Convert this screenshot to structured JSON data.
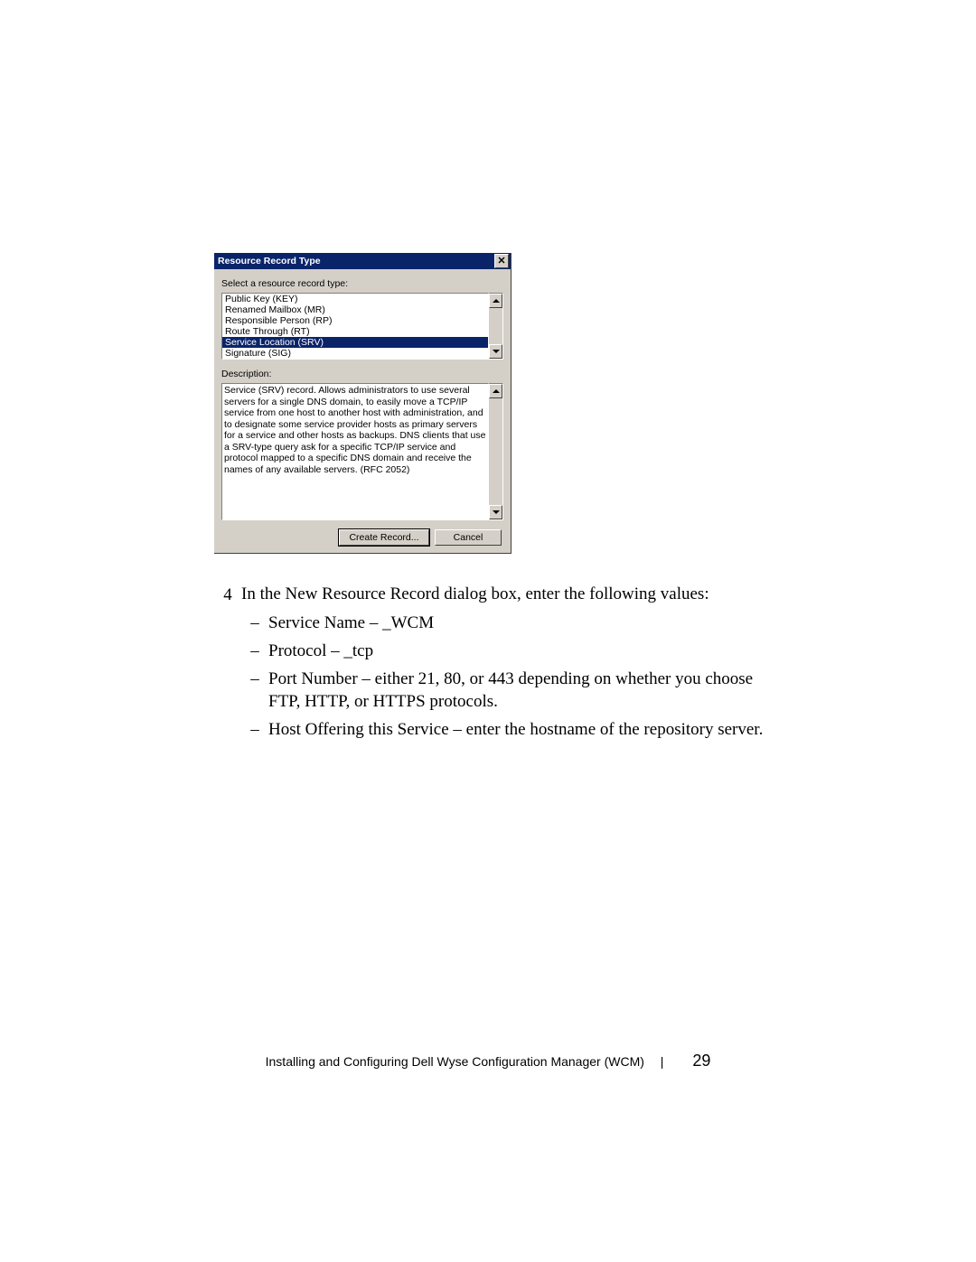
{
  "dialog": {
    "title": "Resource Record Type",
    "select_label": "Select a resource record type:",
    "items": [
      "Public Key (KEY)",
      "Renamed Mailbox (MR)",
      "Responsible Person (RP)",
      "Route Through (RT)",
      "Service Location (SRV)",
      "Signature (SIG)"
    ],
    "selected_index": 4,
    "description_label": "Description:",
    "description": "Service (SRV) record. Allows administrators to use several servers for a single DNS domain, to easily move a TCP/IP service from one host to another host with administration, and to designate some service provider hosts as primary servers for a service and other hosts as backups. DNS clients that use a SRV-type query ask for a specific TCP/IP service and protocol mapped to a specific DNS domain and receive the names of any available servers. (RFC 2052)",
    "create_button": "Create Record...",
    "cancel_button": "Cancel"
  },
  "doc": {
    "step_num": "4",
    "step_text": "In the New Resource Record dialog box, enter the following values:",
    "bullets": [
      "Service Name – _WCM",
      "Protocol – _tcp",
      "Port Number – either 21, 80, or 443 depending on whether you choose FTP, HTTP, or HTTPS protocols.",
      "Host Offering this Service – enter the hostname of the repository server."
    ]
  },
  "footer": {
    "text": "Installing and Configuring Dell Wyse Configuration Manager (WCM)",
    "page": "29"
  }
}
